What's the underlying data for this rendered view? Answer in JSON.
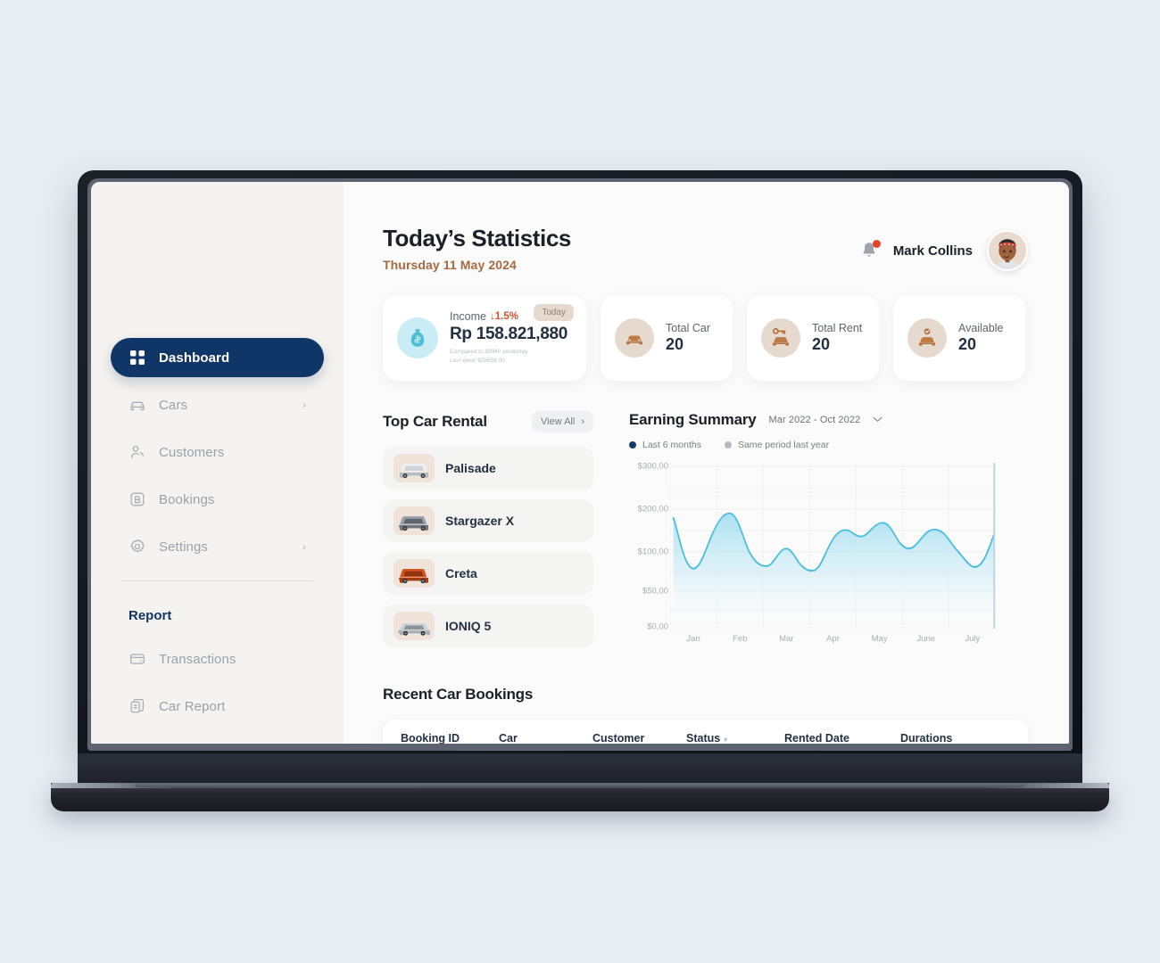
{
  "sidebar": {
    "items": [
      {
        "label": "Dashboard",
        "icon": "grid-icon",
        "active": true,
        "chevron": ""
      },
      {
        "label": "Cars",
        "icon": "car-icon",
        "active": false,
        "chevron": "›"
      },
      {
        "label": "Customers",
        "icon": "users-icon",
        "active": false,
        "chevron": ""
      },
      {
        "label": "Bookings",
        "icon": "booking-icon",
        "active": false,
        "chevron": ""
      },
      {
        "label": "Settings",
        "icon": "gear-icon",
        "active": false,
        "chevron": "›"
      }
    ],
    "report_heading": "Report",
    "report_items": [
      {
        "label": "Transactions",
        "icon": "card-icon"
      },
      {
        "label": "Car Report",
        "icon": "document-icon"
      }
    ]
  },
  "header": {
    "title": "Today’s Statistics",
    "date": "Thursday 11 May 2024",
    "user_name": "Mark Collins",
    "bell_icon": "bell-icon",
    "has_notification": true
  },
  "stats": {
    "income": {
      "label": "Income",
      "delta": "↓1.5%",
      "value": "Rp 158.821,880",
      "sub_line_1": "Compared to $9940 yesterday",
      "sub_line_2": "Last week $25658.00",
      "badge": "Today",
      "icon": "money-bag-icon"
    },
    "cards": [
      {
        "label": "Total Car",
        "value": "20",
        "icon": "car-front-icon"
      },
      {
        "label": "Total Rent",
        "value": "20",
        "icon": "car-key-icon"
      },
      {
        "label": "Available",
        "value": "20",
        "icon": "car-check-icon"
      }
    ]
  },
  "top_car_rental": {
    "title": "Top Car Rental",
    "view_all": "View All",
    "chevron": "›",
    "cars": [
      {
        "name": "Palisade",
        "color": "#e9ebee",
        "accent": "#b9bfc6"
      },
      {
        "name": "Stargazer X",
        "color": "#8d949c",
        "accent": "#5f666e"
      },
      {
        "name": "Creta",
        "color": "#d6551f",
        "accent": "#a33c12"
      },
      {
        "name": "IONIQ 5",
        "color": "#c3c8cd",
        "accent": "#8e949b"
      }
    ]
  },
  "earning_summary": {
    "title": "Earning Summary",
    "range": "Mar 2022 - Oct 2022",
    "chevron": "⌄",
    "legend": [
      {
        "label": "Last 6 months",
        "color": "#123a6b"
      },
      {
        "label": "Same period last year",
        "color": "#b6bbc2"
      }
    ]
  },
  "chart_data": {
    "type": "area",
    "title": "Earning Summary",
    "xlabel": "",
    "ylabel": "",
    "grid": true,
    "legend_position": "top-left",
    "line_color": "#2cb3d9",
    "fill_color": "#b7e4f2",
    "x_tick_labels": [
      "Jan",
      "Feb",
      "Mar",
      "Apr",
      "May",
      "June",
      "July"
    ],
    "y_tick_labels": [
      "$0,00",
      "$50,00",
      "$100,00",
      "$200,00",
      "$300,00"
    ],
    "y_tick_values": [
      0,
      50,
      100,
      200,
      300
    ],
    "ylim": [
      0,
      300
    ],
    "marker_line_x": "July",
    "series": [
      {
        "name": "Last 6 months",
        "x": [
          "Jan",
          "Jan+",
          "Feb-",
          "Feb",
          "Feb+",
          "Mar-",
          "Mar",
          "Mar+",
          "Apr-",
          "Apr",
          "Apr+",
          "May-",
          "May",
          "May+",
          "June-",
          "June",
          "June+",
          "July-",
          "July"
        ],
        "values": [
          152,
          75,
          85,
          158,
          95,
          80,
          110,
          78,
          72,
          135,
          120,
          140,
          88,
          112,
          150,
          142,
          120,
          95,
          140
        ]
      }
    ]
  },
  "recent_bookings": {
    "title": "Recent Car Bookings",
    "columns": [
      {
        "label": "Booking ID",
        "sortable": false
      },
      {
        "label": "Car",
        "sortable": false
      },
      {
        "label": "Customer",
        "sortable": false
      },
      {
        "label": "Status",
        "sortable": true
      },
      {
        "label": "Rented Date",
        "sortable": false
      },
      {
        "label": "Durations",
        "sortable": false
      }
    ],
    "sort_glyph": "▾"
  },
  "colors": {
    "sidebar_bg": "#f5f3ef",
    "active_nav": "#103668",
    "accent_date": "#a6693f",
    "chart_line": "#2cb3d9",
    "badge_bg": "#e6d9cd"
  }
}
